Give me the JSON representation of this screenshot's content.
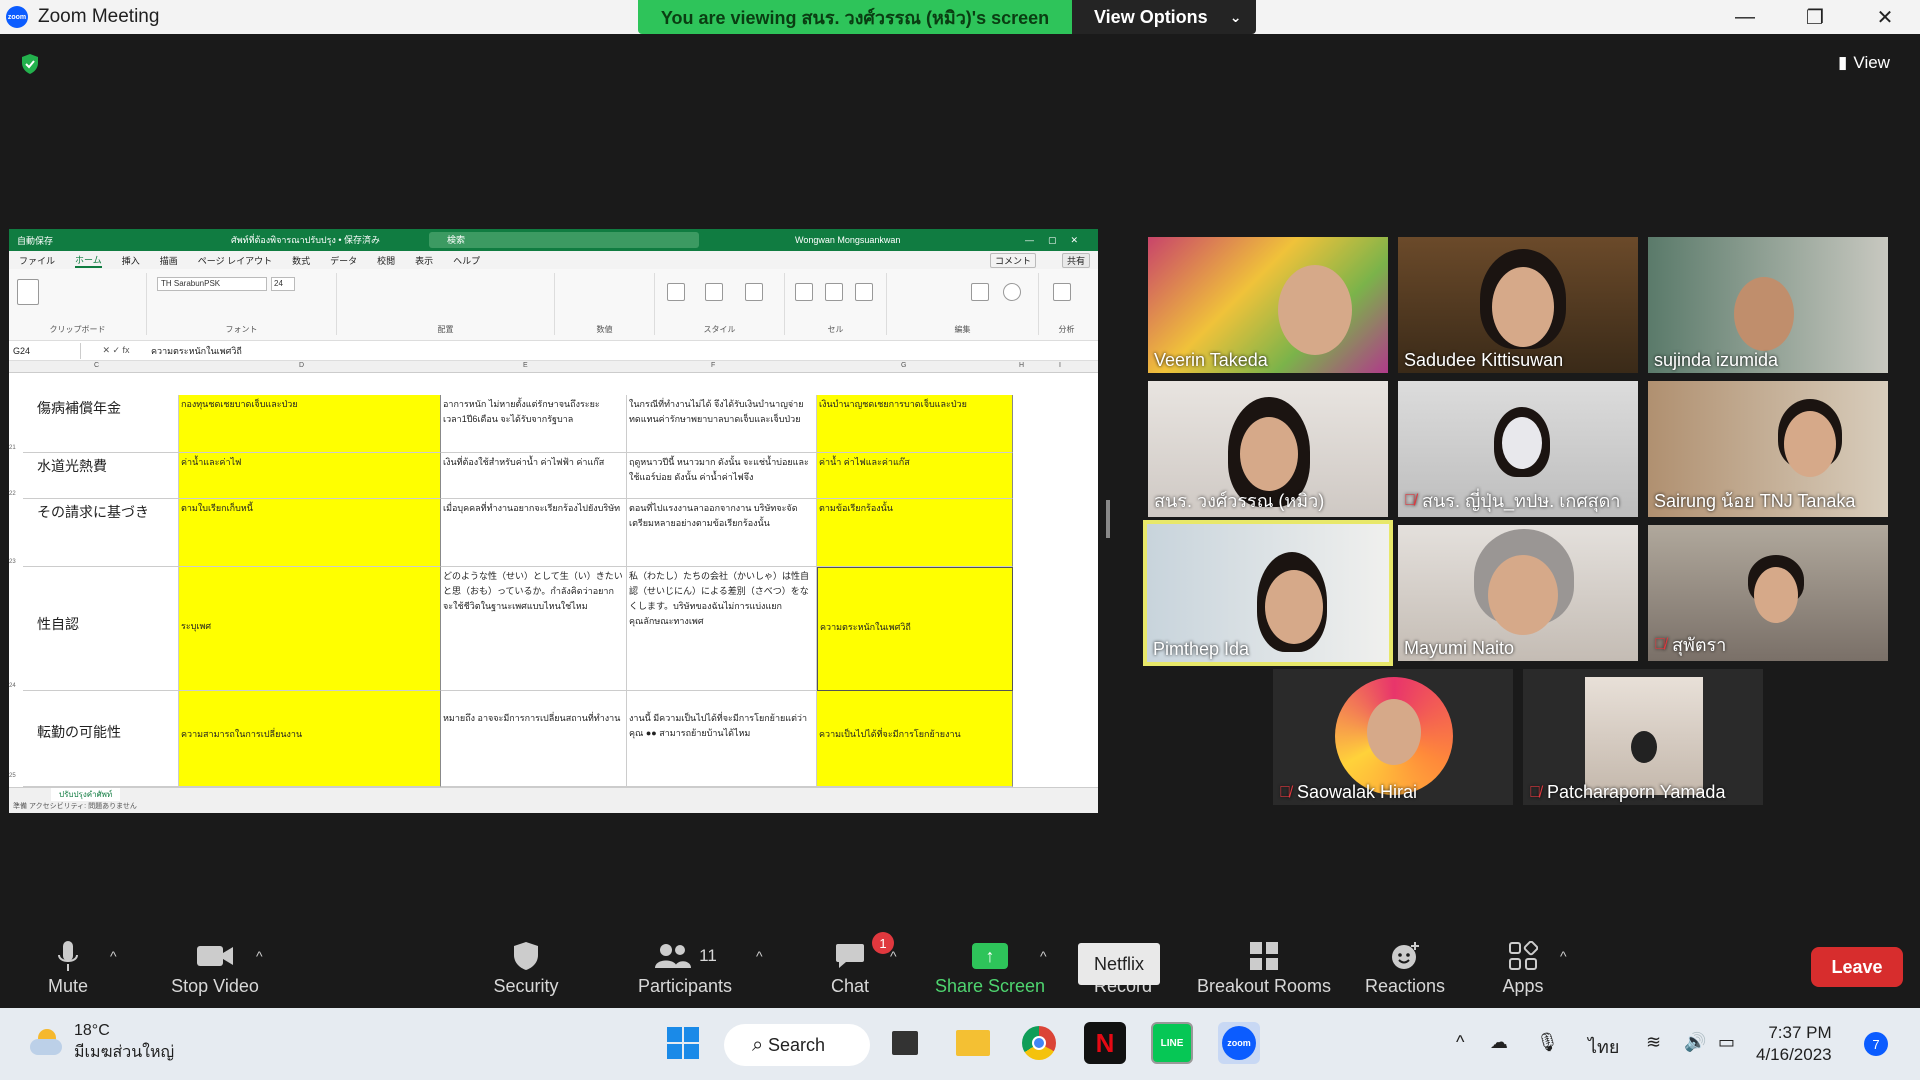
{
  "window": {
    "title": "Zoom Meeting",
    "share_banner": "You are viewing สนร. วงศ์วรรณ (หมิว)'s screen",
    "view_options": "View Options",
    "view_button": "View"
  },
  "excel": {
    "autosave": "自動保存",
    "filename": "ศัพท์ที่ต้องพิจารณาปรับปรุง • 保存済み",
    "search": "検索",
    "user": "Wongwan Mongsuankwan",
    "menu": [
      "ファイル",
      "ホーム",
      "挿入",
      "描画",
      "ページ レイアウト",
      "数式",
      "データ",
      "校閲",
      "表示",
      "ヘルプ"
    ],
    "comment": "コメント",
    "share": "共有",
    "font": "TH SarabunPSK",
    "font_size": "24",
    "ribbon_groups": [
      "クリップボード",
      "フォント",
      "配置",
      "数値",
      "スタイル",
      "セル",
      "編集",
      "分析"
    ],
    "name_box": "G24",
    "formula": "ความตระหนักในเพศวิถี",
    "columns": [
      "C",
      "D",
      "E",
      "F",
      "G",
      "H",
      "I"
    ],
    "rows": [
      {
        "num": "21",
        "c": "傷病補償年金",
        "d": "กองทุนชดเชยบาดเจ็บและป่วย",
        "e": "อาการหนัก ไม่หายตั้งแต่รักษาจนถึงระยะเวลา1ปี6เดือน จะได้รับจากรัฐบาล",
        "f": "ในกรณีที่ทำงานไม่ได้ จึงได้รับเงินบำนาญจ่ายทดแทนค่ารักษาพยาบาลบาดเจ็บและเจ็บป่วย",
        "g": "เงินบำนาญชดเชยการบาดเจ็บและป่วย"
      },
      {
        "num": "22",
        "c": "水道光熱費",
        "d": "ค่าน้ำและค่าไฟ",
        "e": "เงินที่ต้องใช้สำหรับค่าน้ำ ค่าไฟฟ้า ค่าแก๊ส",
        "f": "ฤดูหนาวปีนี้ หนาวมาก ดังนั้น จะแช่น้ำบ่อยและใช้แอร์บ่อย ดังนั้น ค่าน้ำค่าไฟจึง",
        "g": "ค่าน้ำ ค่าไฟและค่าแก๊ส"
      },
      {
        "num": "23",
        "c": "その請求に基づき",
        "d": "ตามใบเรียกเก็บหนี้",
        "e": "เมื่อบุคคลที่ทำงานอยากจะเรียกร้องไปยังบริษัท",
        "f": "ตอนที่ไปแรงงานลาออกจากงาน บริษัทจะจัดเตรียมหลายอย่างตามข้อเรียกร้องนั้น",
        "g": "ตามข้อเรียกร้องนั้น"
      },
      {
        "num": "24",
        "c": "性自認",
        "d": "ระบุเพศ",
        "e": "どのような性（せい）として生（い）きたいと思（おも）っているか。กำลังคิดว่าอยากจะใช้ชีวิตในฐานะเพศแบบไหนใช่ไหม",
        "f": "私（わたし）たちの会社（かいしゃ）は性自認（せいじにん）による差別（さべつ）をなくします。บริษัทของฉันไม่การแบ่งแยกคุณลักษณะทางเพศ",
        "g": "ความตระหนักในเพศวิถี"
      },
      {
        "num": "25",
        "c": "転勤の可能性",
        "d": "ความสามารถในการเปลี่ยนงาน",
        "e": "หมายถึง อาจจะมีการการเปลี่ยนสถานที่ทำงาน",
        "f": "งานนี้ มีความเป็นไปได้ที่จะมีการโยกย้ายแต่ว่า คุณ ●● สามารถย้ายบ้านได้ไหม",
        "g": "ความเป็นไปได้ที่จะมีการโยกย้ายงาน"
      }
    ],
    "sheet_tab": "ปรับปรุงคำศัพท์",
    "status": "準備    アクセシビリティ: 問題ありません"
  },
  "participants": [
    {
      "name": "Veerin Takeda",
      "muted": false,
      "active": false
    },
    {
      "name": "Sadudee Kittisuwan",
      "muted": false,
      "active": false
    },
    {
      "name": "sujinda izumida",
      "muted": false,
      "active": false
    },
    {
      "name": "สนร. วงศ์วรรณ (หมิว)",
      "muted": false,
      "active": false
    },
    {
      "name": "สนร. ญี่ปุ่น_ทปษ. เกศสุดา",
      "muted": true,
      "active": false
    },
    {
      "name": "Sairung  น้อย TNJ Tanaka",
      "muted": false,
      "active": false
    },
    {
      "name": "Pimthep Ida",
      "muted": false,
      "active": true
    },
    {
      "name": "Mayumi Naito",
      "muted": false,
      "active": false
    },
    {
      "name": "สุพัตรา",
      "muted": true,
      "active": false
    },
    {
      "name": "Saowalak Hirai",
      "muted": true,
      "active": false
    },
    {
      "name": "Patcharaporn Yamada",
      "muted": true,
      "active": false
    }
  ],
  "toolbar": {
    "mute": "Mute",
    "stop_video": "Stop Video",
    "security": "Security",
    "participants": "Participants",
    "participants_count": "11",
    "chat": "Chat",
    "chat_badge": "1",
    "share_screen": "Share Screen",
    "record": "Record",
    "breakout": "Breakout Rooms",
    "reactions": "Reactions",
    "apps": "Apps",
    "tooltip": "Netflix",
    "leave": "Leave"
  },
  "taskbar": {
    "temp": "18°C",
    "weather": "มีเมฆส่วนใหญ่",
    "search": "Search",
    "lang": "ไทย",
    "time": "7:37 PM",
    "date": "4/16/2023",
    "notifications": "7"
  },
  "colors": {
    "share_green": "#2ec45a",
    "leave_red": "#d72d2d",
    "excel_green": "#107c41",
    "highlight_yellow": "#ffff00",
    "active_speaker": "#e8e86a"
  }
}
